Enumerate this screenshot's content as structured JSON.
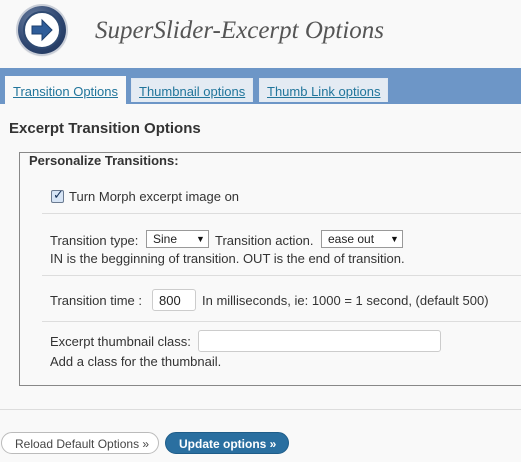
{
  "header": {
    "title": "SuperSlider-Excerpt Options",
    "icon": "arrow-right-icon"
  },
  "tabs": [
    {
      "label": "Transition Options",
      "active": true
    },
    {
      "label": "Thumbnail options",
      "active": false
    },
    {
      "label": "Thumb Link options",
      "active": false
    }
  ],
  "section": {
    "title": "Excerpt Transition Options",
    "legend": "Personalize Transitions:"
  },
  "morph": {
    "label": "Turn Morph excerpt image on",
    "checked": true
  },
  "transition": {
    "type_label": "Transition type:",
    "type_value": "Sine",
    "action_label": "Transition action.",
    "action_value": "ease out",
    "help": "IN is the begginning of transition. OUT is the end of transition."
  },
  "time": {
    "label": "Transition time :",
    "value": "800",
    "help": "In milliseconds, ie: 1000 = 1 second, (default 500)"
  },
  "thumb_class": {
    "label": "Excerpt thumbnail class:",
    "value": "",
    "help": "Add a class for the thumbnail."
  },
  "buttons": {
    "reload": "Reload Default Options »",
    "update": "Update options »"
  },
  "colors": {
    "tabbar": "#6d96c7",
    "link": "#21759b",
    "primary_button": "#2a6fa0"
  }
}
